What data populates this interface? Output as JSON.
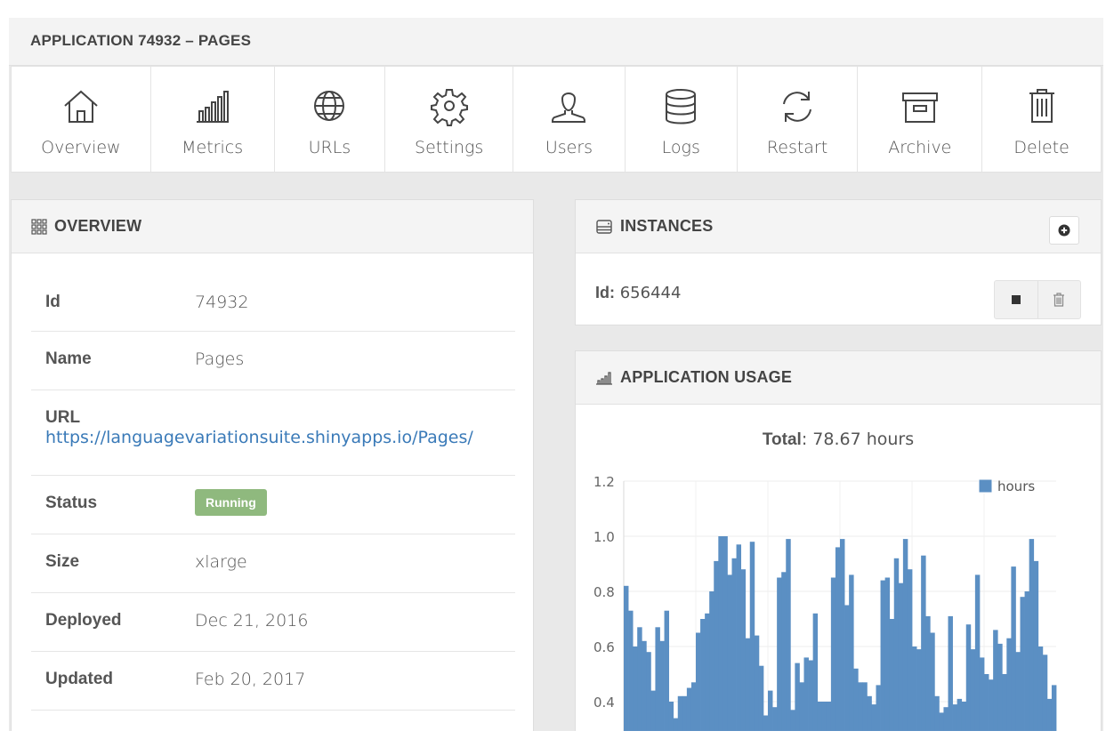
{
  "header": {
    "title": "APPLICATION 74932 – PAGES"
  },
  "toolbar": {
    "items": [
      {
        "label": "Overview",
        "icon": "home-icon"
      },
      {
        "label": "Metrics",
        "icon": "bar-chart-icon"
      },
      {
        "label": "URLs",
        "icon": "globe-icon"
      },
      {
        "label": "Settings",
        "icon": "gear-icon"
      },
      {
        "label": "Users",
        "icon": "user-icon"
      },
      {
        "label": "Logs",
        "icon": "database-icon"
      },
      {
        "label": "Restart",
        "icon": "refresh-icon"
      },
      {
        "label": "Archive",
        "icon": "archive-box-icon"
      },
      {
        "label": "Delete",
        "icon": "trash-icon"
      }
    ]
  },
  "overview": {
    "title": "OVERVIEW",
    "rows": [
      {
        "key": "Id",
        "value": "74932"
      },
      {
        "key": "Name",
        "value": "Pages"
      },
      {
        "key": "URL",
        "value": "https://languagevariationsuite.shinyapps.io/Pages/"
      },
      {
        "key": "Status",
        "value": "Running"
      },
      {
        "key": "Size",
        "value": "xlarge"
      },
      {
        "key": "Deployed",
        "value": "Dec 21, 2016"
      },
      {
        "key": "Updated",
        "value": "Feb 20, 2017"
      }
    ],
    "status_color": "#8fb97e"
  },
  "instances": {
    "title": "INSTANCES",
    "id_label": "Id:",
    "id_value": "656444"
  },
  "usage": {
    "title": "APPLICATION USAGE",
    "total_label": "Total",
    "total_value": ": 78.67 hours"
  },
  "colors": {
    "accent": "#5b8fc3",
    "link": "#3a7ab8"
  },
  "chart_data": {
    "type": "bar",
    "title": "",
    "xlabel": "",
    "ylabel": "",
    "ylim": [
      0.3,
      1.2
    ],
    "yticks": [
      "1.2",
      "1.0",
      "0.8",
      "0.6",
      "0.4"
    ],
    "legend": "top-right",
    "grid": true,
    "series": [
      {
        "name": "hours",
        "color": "#5b8fc3",
        "values": [
          0.82,
          0.73,
          0.6,
          0.67,
          0.62,
          0.58,
          0.44,
          0.67,
          0.62,
          0.73,
          0.4,
          0.34,
          0.42,
          0.42,
          0.45,
          0.47,
          0.65,
          0.7,
          0.72,
          0.8,
          0.91,
          1.0,
          1.0,
          0.86,
          0.92,
          0.97,
          0.88,
          0.63,
          0.98,
          0.64,
          0.53,
          0.35,
          0.44,
          0.38,
          0.85,
          0.87,
          0.99,
          0.37,
          0.54,
          0.47,
          0.56,
          0.55,
          0.72,
          0.4,
          0.4,
          0.4,
          0.85,
          0.96,
          0.99,
          0.75,
          0.86,
          0.52,
          0.47,
          0.47,
          0.42,
          0.39,
          0.46,
          0.84,
          0.85,
          0.7,
          0.92,
          0.83,
          0.99,
          0.88,
          0.6,
          0.59,
          0.93,
          0.71,
          0.65,
          0.42,
          0.36,
          0.38,
          0.71,
          0.39,
          0.41,
          0.4,
          0.68,
          0.59,
          0.86,
          0.56,
          0.5,
          0.48,
          0.66,
          0.61,
          0.5,
          0.63,
          0.89,
          0.58,
          0.78,
          0.8,
          0.99,
          0.91,
          0.6,
          0.57,
          0.41,
          0.46
        ]
      }
    ]
  }
}
